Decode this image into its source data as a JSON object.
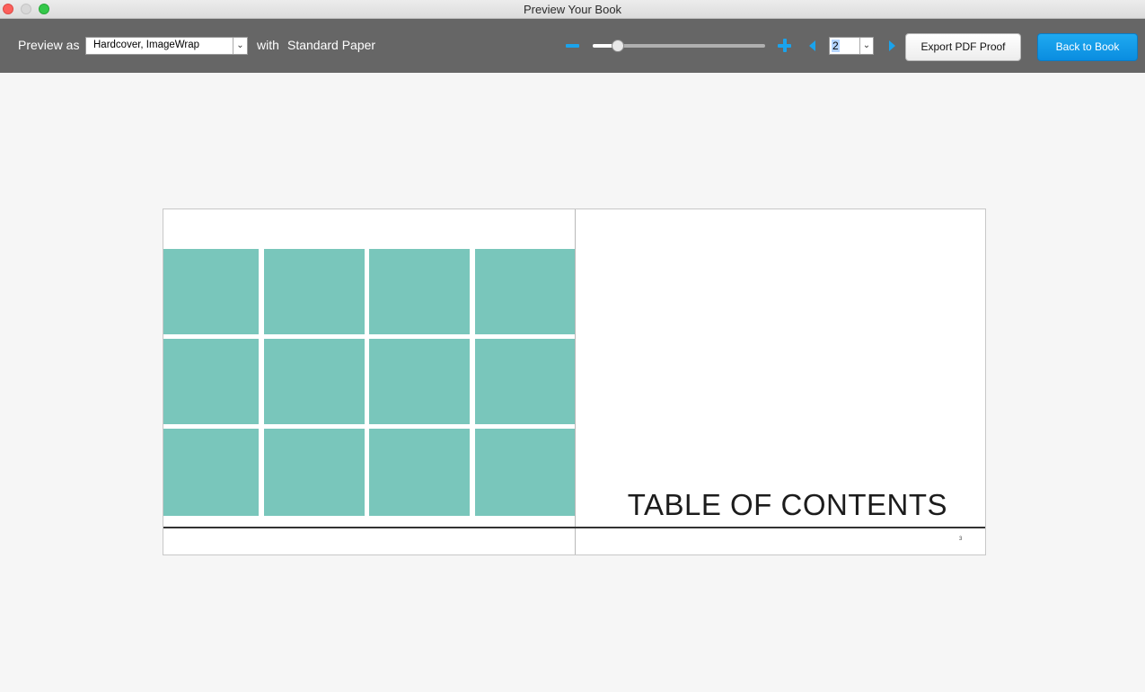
{
  "window": {
    "title": "Preview Your Book"
  },
  "toolbar": {
    "preview_as_label": "Preview as",
    "cover_value": "Hardcover, ImageWrap",
    "with_label": "with",
    "paper_label": "Standard Paper",
    "zoom_level": 0.12,
    "page_value": "2",
    "export_label": "Export PDF Proof",
    "back_label": "Back to Book"
  },
  "book": {
    "right_page_title": "TABLE OF CONTENTS",
    "right_page_number": "3",
    "tile_color": "#79c6bb"
  },
  "colors": {
    "accent": "#1aa3ec",
    "toolbar_bg": "#666666"
  }
}
